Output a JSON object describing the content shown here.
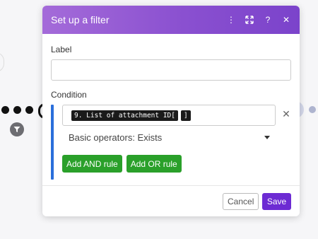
{
  "dialog": {
    "title": "Set up a filter",
    "header_icons": [
      {
        "name": "more-vertical-icon",
        "glyph": "⋮"
      },
      {
        "name": "expand-icon",
        "glyph": "⤧"
      },
      {
        "name": "help-icon",
        "glyph": "?"
      },
      {
        "name": "close-icon",
        "glyph": "✕"
      }
    ],
    "label_field": {
      "label": "Label",
      "value": "",
      "placeholder": ""
    },
    "condition": {
      "label": "Condition",
      "tokens": [
        "9. List of attachment ID[",
        "]"
      ],
      "operator": "Basic operators: Exists",
      "remove_glyph": "✕"
    },
    "rule_buttons": {
      "and_label": "Add AND rule",
      "or_label": "Add OR rule"
    },
    "footer": {
      "cancel_label": "Cancel",
      "save_label": "Save"
    }
  },
  "colors": {
    "header_gradient_start": "#a46bd9",
    "header_gradient_end": "#7b43cb",
    "condition_bar": "#2a6fdb",
    "rule_button": "#2aa02a",
    "save_button": "#6d2bd3"
  }
}
